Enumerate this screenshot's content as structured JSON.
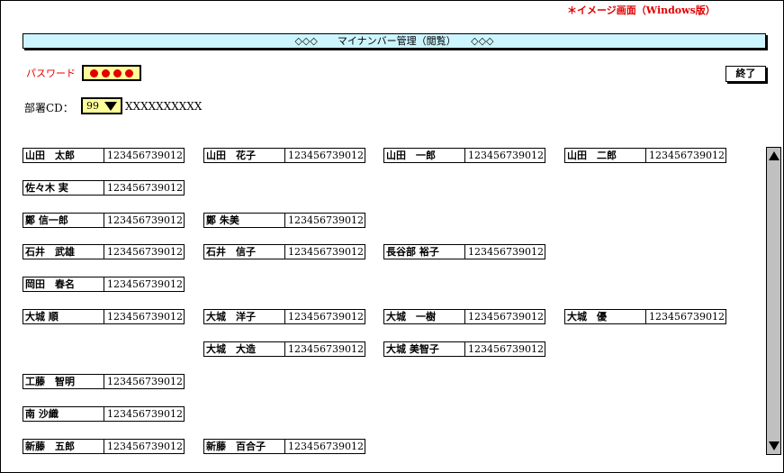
{
  "note": "＊イメージ画面（Windows版）",
  "title": "◇◇◇　　マイナンバー管理（閲覧）　　◇◇◇",
  "password": {
    "label": "パスワード",
    "mask": "●●●●"
  },
  "end_button": "終了",
  "department": {
    "label": "部署CD：",
    "code": "99",
    "name": "XXXXXXXXXX"
  },
  "employees": [
    {
      "name": "山田　太郎",
      "number": "123456739012"
    },
    {
      "name": "山田　花子",
      "number": "123456739012"
    },
    {
      "name": "山田　一郎",
      "number": "123456739012"
    },
    {
      "name": "山田　二郎",
      "number": "123456739012"
    },
    {
      "name": "佐々木 実",
      "number": "123456739012"
    },
    {
      "name": "鄭 信一郎",
      "number": "123456739012"
    },
    {
      "name": "鄭 朱美",
      "number": "123456739012"
    },
    {
      "name": "石井　武雄",
      "number": "123456739012"
    },
    {
      "name": "石井　信子",
      "number": "123456739012"
    },
    {
      "name": "長谷部 裕子",
      "number": "123456739012"
    },
    {
      "name": "岡田　春名",
      "number": "123456739012"
    },
    {
      "name": "大城 順",
      "number": "123456739012"
    },
    {
      "name": "大城　洋子",
      "number": "123456739012"
    },
    {
      "name": "大城　一樹",
      "number": "123456739012"
    },
    {
      "name": "大城　優",
      "number": "123456739012"
    },
    {
      "name": "大城　大造",
      "number": "123456739012"
    },
    {
      "name": "大城 美智子",
      "number": "123456739012"
    },
    {
      "name": "工藤　智明",
      "number": "123456739012"
    },
    {
      "name": "南 沙織",
      "number": "123456739012"
    },
    {
      "name": "新藤　五郎",
      "number": "123456739012"
    },
    {
      "name": "新藤　百合子",
      "number": "123456739012"
    }
  ]
}
